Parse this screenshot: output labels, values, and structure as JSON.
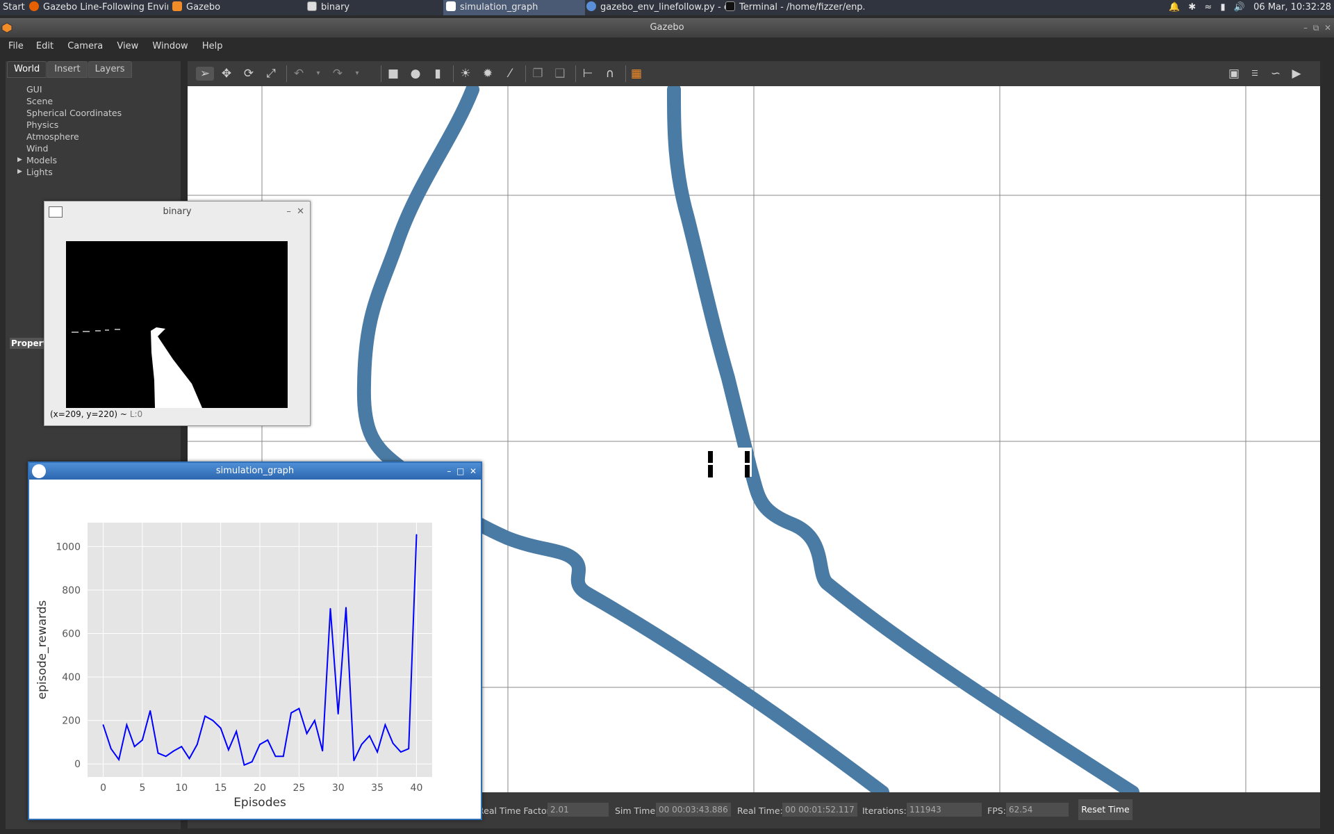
{
  "taskbar": {
    "start": "Start",
    "tasks": [
      {
        "label": "Gazebo Line-Following Envir...",
        "icon": "firefox-icon"
      },
      {
        "label": "Gazebo",
        "icon": "gazebo-icon"
      },
      {
        "label": "binary",
        "icon": "window-icon"
      },
      {
        "label": "simulation_graph",
        "icon": "python-graph-icon"
      },
      {
        "label": "gazebo_env_linefollow.py - e...",
        "icon": "editor-icon"
      },
      {
        "label": "Terminal - /home/fizzer/enp...",
        "icon": "terminal-icon"
      }
    ],
    "clock": "06 Mar, 10:32:28"
  },
  "window": {
    "title": "Gazebo"
  },
  "menu": [
    "File",
    "Edit",
    "Camera",
    "View",
    "Window",
    "Help"
  ],
  "left_panel": {
    "tabs": [
      "World",
      "Insert",
      "Layers"
    ],
    "items": [
      "GUI",
      "Scene",
      "Spherical Coordinates",
      "Physics",
      "Atmosphere",
      "Wind",
      "Models",
      "Lights"
    ],
    "properties_label": "Property"
  },
  "toolbar": {
    "icons": [
      "select-arrow-icon",
      "translate-icon",
      "rotate-icon",
      "scale-icon",
      "undo-icon",
      "redo-icon",
      "box-icon",
      "sphere-icon",
      "cylinder-icon",
      "point-light-icon",
      "spot-light-icon",
      "directional-light-icon",
      "copy-icon",
      "paste-icon",
      "align-icon",
      "snap-icon",
      "view-angle-icon",
      "screenshot-icon",
      "log-icon",
      "plot-icon",
      "video-icon"
    ]
  },
  "bottom_bar": {
    "rtf_label": "Real Time Factor:",
    "rtf_value": "2.01",
    "sim_label": "Sim Time:",
    "sim_value": "00 00:03:43.886",
    "real_label": "Real Time:",
    "real_value": "00 00:01:52.117",
    "iter_label": "Iterations:",
    "iter_value": "111943",
    "fps_label": "FPS:",
    "fps_value": "62.54",
    "reset_label": "Reset Time"
  },
  "binary_window": {
    "title": "binary",
    "status": "(x=209, y=220) ~",
    "status_extra": "L:0"
  },
  "graph_window": {
    "title": "simulation_graph"
  },
  "chart_data": {
    "type": "line",
    "xlabel": "Episodes",
    "ylabel": "episode_rewards",
    "xlim": [
      -2,
      42
    ],
    "ylim": [
      -60,
      1110
    ],
    "xticks": [
      0,
      5,
      10,
      15,
      20,
      25,
      30,
      35,
      40
    ],
    "yticks": [
      0,
      200,
      400,
      600,
      800,
      1000
    ],
    "grid": true,
    "color": "#0000ff",
    "x": [
      0,
      1,
      2,
      3,
      4,
      5,
      6,
      7,
      8,
      9,
      10,
      11,
      12,
      13,
      14,
      15,
      16,
      17,
      18,
      19,
      20,
      21,
      22,
      23,
      24,
      25,
      26,
      27,
      28,
      29,
      30,
      31,
      32,
      33,
      34,
      35,
      36,
      37,
      38,
      39,
      40
    ],
    "y": [
      180,
      70,
      20,
      180,
      80,
      110,
      245,
      50,
      35,
      60,
      80,
      25,
      90,
      220,
      200,
      165,
      65,
      150,
      -5,
      10,
      90,
      110,
      35,
      35,
      235,
      255,
      140,
      200,
      60,
      715,
      230,
      720,
      15,
      90,
      130,
      55,
      180,
      95,
      55,
      70,
      1055
    ]
  }
}
